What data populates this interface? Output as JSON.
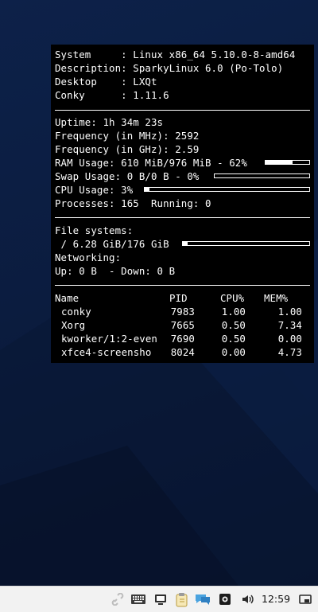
{
  "system_info": {
    "rows": [
      {
        "label": "System     :",
        "value": "Linux x86_64 5.10.0-8-amd64"
      },
      {
        "label": "Description:",
        "value": "SparkyLinux 6.0 (Po-Tolo)"
      },
      {
        "label": "Desktop    :",
        "value": "LXQt"
      },
      {
        "label": "Conky      :",
        "value": "1.11.6"
      }
    ]
  },
  "stats": {
    "uptime": "Uptime: 1h 34m 23s",
    "freq_mhz": "Frequency (in MHz): 2592",
    "freq_ghz": "Frequency (in GHz): 2.59",
    "ram": "RAM Usage: 610 MiB/976 MiB - 62%",
    "ram_percent": 62,
    "swap": "Swap Usage: 0 B/0 B - 0%",
    "swap_percent": 0,
    "cpu": "CPU Usage: 3%",
    "cpu_percent": 3,
    "processes": "Processes: 165  Running: 0"
  },
  "filesystems": {
    "title": "File systems:",
    "root": " / 6.28 GiB/176 GiB",
    "root_percent": 4,
    "networking_title": "Networking:",
    "net": "Up: 0 B  - Down: 0 B"
  },
  "processes": {
    "headers": {
      "name": "Name",
      "pid": "PID",
      "cpu": "CPU%",
      "mem": "MEM%"
    },
    "rows": [
      {
        "name": "conky",
        "pid": "7983",
        "cpu": "1.00",
        "mem": "1.00"
      },
      {
        "name": "Xorg",
        "pid": "7665",
        "cpu": "0.50",
        "mem": "7.34"
      },
      {
        "name": "kworker/1:2-even",
        "pid": "7690",
        "cpu": "0.50",
        "mem": "0.00"
      },
      {
        "name": "xfce4-screensho",
        "pid": "8024",
        "cpu": "0.00",
        "mem": "4.73"
      }
    ]
  },
  "taskbar": {
    "clock": "12:59",
    "icons": [
      "link-icon",
      "keyboard-icon",
      "monitor-icon",
      "clipboard-icon",
      "chat-icon",
      "screenshot-icon",
      "volume-icon",
      "show-desktop-icon"
    ]
  },
  "colors": {
    "conky_bg": "#000000",
    "conky_fg": "#ffffff",
    "panel_bg": "#f2f2f2",
    "desktop_bg": "#0d2149"
  }
}
